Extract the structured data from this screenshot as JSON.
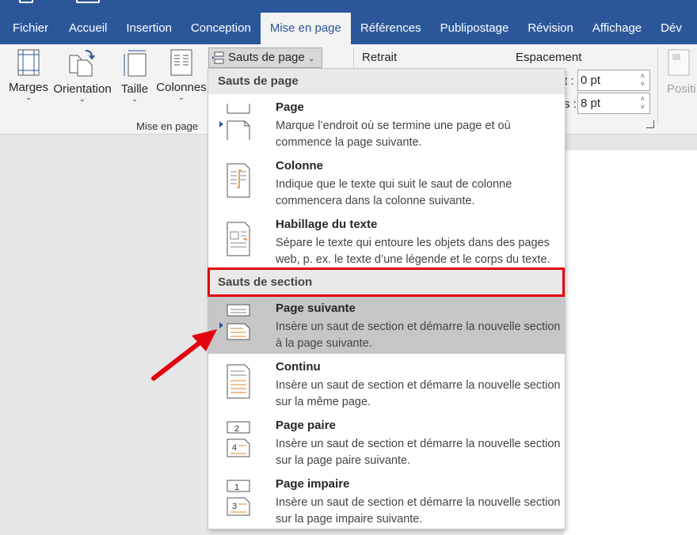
{
  "tabs": [
    "Fichier",
    "Accueil",
    "Insertion",
    "Conception",
    "Mise en page",
    "Références",
    "Publipostage",
    "Révision",
    "Affichage",
    "Dév"
  ],
  "ribbon": {
    "margins": "Marges",
    "orientation": "Orientation",
    "size": "Taille",
    "columns": "Colonnes",
    "group_label": "Mise en page",
    "breaks_button": "Sauts de page",
    "indent_label": "Retrait",
    "spacing_label": "Espacement",
    "before_frag": "t :",
    "after_frag": "s :",
    "before_value": "0 pt",
    "after_value": "8 pt",
    "position": "Positi"
  },
  "dropdown": {
    "page_breaks_header": "Sauts de page",
    "section_breaks_header": "Sauts de section",
    "page_breaks": [
      {
        "title": "Page",
        "desc": "Marque l’endroit où se termine une page et où commence la page suivante."
      },
      {
        "title": "Colonne",
        "desc": "Indique que le texte qui suit le saut de colonne commencera dans la colonne suivante."
      },
      {
        "title": "Habillage du texte",
        "desc": "Sépare le texte qui entoure les objets dans des pages web, p. ex. le texte d’une légende et le corps du texte."
      }
    ],
    "section_breaks": [
      {
        "title": "Page suivante",
        "desc": "Insère un saut de section et démarre la nouvelle section à la page suivante."
      },
      {
        "title": "Continu",
        "desc": "Insère un saut de section et démarre la nouvelle section sur la même page."
      },
      {
        "title": "Page paire",
        "desc": "Insère un saut de section et démarre la nouvelle section sur la page paire suivante."
      },
      {
        "title": "Page impaire",
        "desc": "Insère un saut de section et démarre la nouvelle section sur la page impaire suivante."
      }
    ]
  },
  "colors": {
    "brand": "#2b579a",
    "highlight": "#e3000f",
    "accent_orange": "#d9892c"
  },
  "icons": [
    "margins-icon",
    "orientation-icon",
    "size-icon",
    "columns-icon",
    "page-break-icon",
    "column-break-icon",
    "text-wrapping-icon",
    "next-page-icon",
    "continuous-icon",
    "even-page-icon",
    "odd-page-icon",
    "annotation-arrow"
  ]
}
